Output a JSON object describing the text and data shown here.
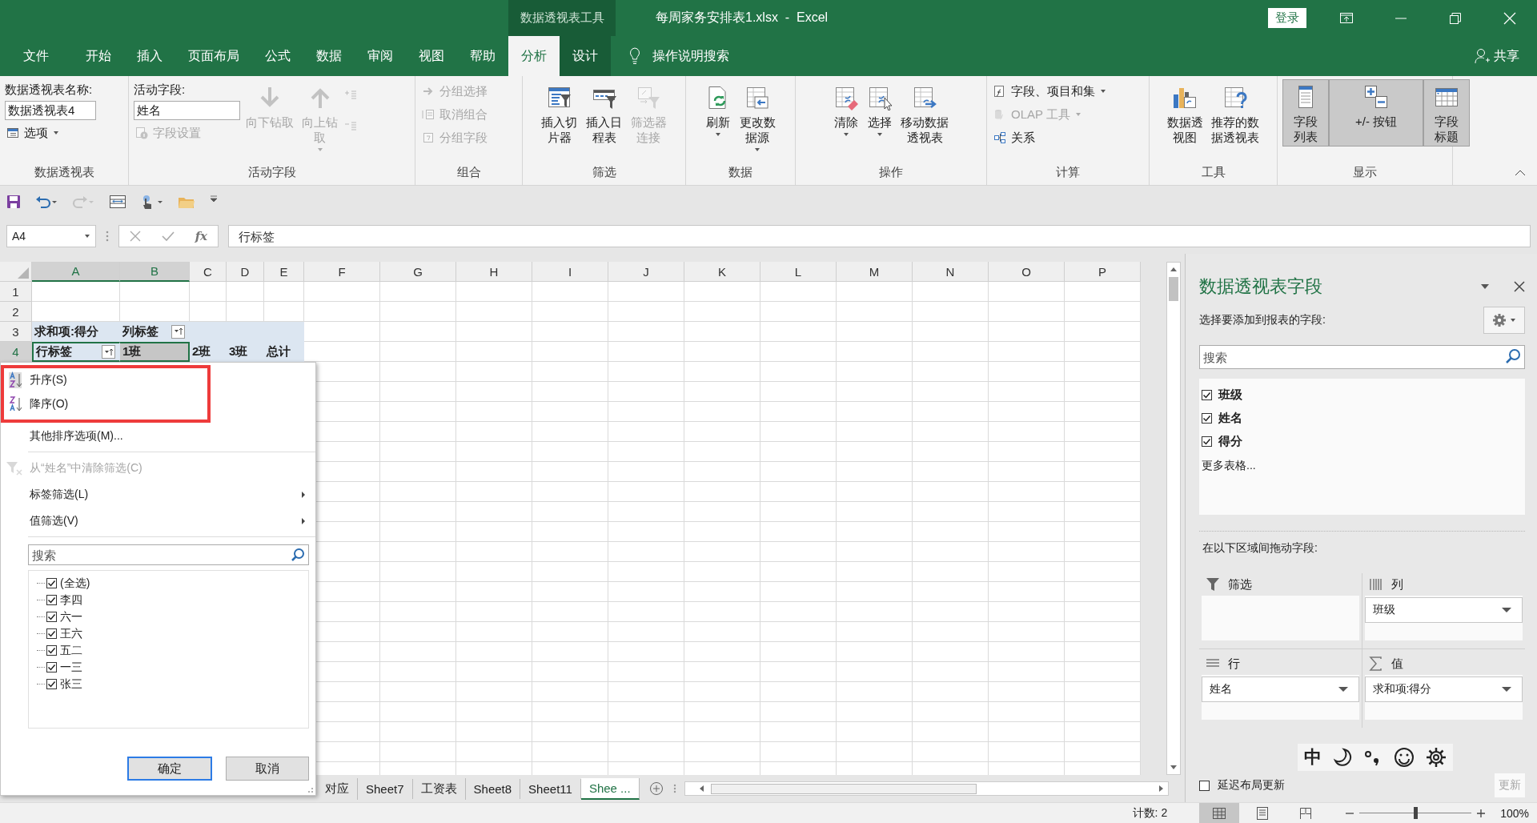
{
  "title_bar": {
    "context_label": "数据透视表工具",
    "title": "每周家务安排表1.xlsx  -  Excel",
    "sign_in": "登录"
  },
  "tabs": [
    {
      "label": "文件",
      "selected": false,
      "contextual": false
    },
    {
      "label": "开始",
      "selected": false,
      "contextual": false
    },
    {
      "label": "插入",
      "selected": false,
      "contextual": false
    },
    {
      "label": "页面布局",
      "selected": false,
      "contextual": false
    },
    {
      "label": "公式",
      "selected": false,
      "contextual": false
    },
    {
      "label": "数据",
      "selected": false,
      "contextual": false
    },
    {
      "label": "审阅",
      "selected": false,
      "contextual": false
    },
    {
      "label": "视图",
      "selected": false,
      "contextual": false
    },
    {
      "label": "帮助",
      "selected": false,
      "contextual": false
    },
    {
      "label": "分析",
      "selected": true,
      "contextual": true
    },
    {
      "label": "设计",
      "selected": false,
      "contextual": true
    }
  ],
  "tell_me": "操作说明搜索",
  "share": "共享",
  "ribbon": [
    {
      "label": "数据透视表",
      "columns": [
        [
          {
            "kind": "caption",
            "text": "数据透视表名称:"
          },
          {
            "kind": "input",
            "value": "数据透视表4"
          },
          {
            "kind": "small",
            "label": "选项",
            "dropdown": true,
            "disabled": false
          }
        ]
      ]
    },
    {
      "label": "活动字段",
      "columns": [
        [
          {
            "kind": "caption",
            "text": "活动字段:"
          },
          {
            "kind": "input",
            "value": "姓名"
          },
          {
            "kind": "small",
            "label": "字段设置",
            "dropdown": false,
            "disabled": true
          }
        ],
        [
          {
            "kind": "large",
            "label": "向下钻取",
            "dropdown": false,
            "disabled": true
          }
        ],
        [
          {
            "kind": "large",
            "label": "向上钻取",
            "dropdown": true,
            "disabled": true
          }
        ],
        [
          {
            "kind": "icon",
            "disabled": true
          },
          {
            "kind": "icon",
            "disabled": true
          }
        ]
      ]
    },
    {
      "label": "组合",
      "columns": [
        [
          {
            "kind": "small",
            "label": "分组选择",
            "dropdown": false,
            "disabled": true
          },
          {
            "kind": "small",
            "label": "取消组合",
            "dropdown": false,
            "disabled": true
          },
          {
            "kind": "small",
            "label": "分组字段",
            "dropdown": false,
            "disabled": true
          }
        ]
      ]
    },
    {
      "label": "筛选",
      "columns": [
        [
          {
            "kind": "large",
            "label": "插入切片器",
            "dropdown": false,
            "disabled": false
          }
        ],
        [
          {
            "kind": "large",
            "label": "插入日程表",
            "dropdown": false,
            "disabled": false
          }
        ],
        [
          {
            "kind": "large",
            "label": "筛选器连接",
            "dropdown": false,
            "disabled": true
          }
        ]
      ]
    },
    {
      "label": "数据",
      "columns": [
        [
          {
            "kind": "large",
            "label": "刷新",
            "dropdown": true,
            "disabled": false
          }
        ],
        [
          {
            "kind": "large",
            "label": "更改数据源",
            "dropdown": true,
            "disabled": false
          }
        ]
      ]
    },
    {
      "label": "操作",
      "columns": [
        [
          {
            "kind": "large",
            "label": "清除",
            "dropdown": true,
            "disabled": false
          }
        ],
        [
          {
            "kind": "large",
            "label": "选择",
            "dropdown": true,
            "disabled": false
          }
        ],
        [
          {
            "kind": "large",
            "label": "移动数据透视表",
            "dropdown": false,
            "disabled": false
          }
        ]
      ]
    },
    {
      "label": "计算",
      "columns": [
        [
          {
            "kind": "small",
            "label": "字段、项目和集",
            "dropdown": true,
            "disabled": false
          },
          {
            "kind": "small",
            "label": "OLAP 工具",
            "dropdown": true,
            "disabled": true
          },
          {
            "kind": "small",
            "label": "关系",
            "dropdown": false,
            "disabled": false
          }
        ]
      ]
    },
    {
      "label": "工具",
      "columns": [
        [
          {
            "kind": "large",
            "label": "数据透视图",
            "dropdown": false,
            "disabled": false
          }
        ],
        [
          {
            "kind": "large",
            "label": "推荐的数据透视表",
            "dropdown": false,
            "disabled": false
          }
        ]
      ]
    },
    {
      "label": "显示",
      "columns": [
        [
          {
            "kind": "toggle",
            "label": "字段列表",
            "selected": true
          }
        ],
        [
          {
            "kind": "toggle",
            "label": "+/- 按钮",
            "selected": true
          }
        ],
        [
          {
            "kind": "toggle",
            "label": "字段标题",
            "selected": true
          }
        ]
      ]
    }
  ],
  "quick_access": [
    {
      "disabled": false
    },
    {
      "disabled": false
    },
    {
      "disabled": true
    },
    {
      "disabled": false
    },
    {
      "disabled": false
    },
    {
      "disabled": false
    },
    {
      "disabled": false
    }
  ],
  "formula_bar": {
    "name_box": "A4",
    "function_label": "fx",
    "value": "行标签"
  },
  "sheet": {
    "columns": [
      {
        "label": "A",
        "selected": true
      },
      {
        "label": "B",
        "selected": true
      },
      {
        "label": "C",
        "selected": false
      },
      {
        "label": "D",
        "selected": false
      },
      {
        "label": "E",
        "selected": false
      },
      {
        "label": "F",
        "selected": false
      },
      {
        "label": "G",
        "selected": false
      },
      {
        "label": "H",
        "selected": false
      },
      {
        "label": "I",
        "selected": false
      },
      {
        "label": "J",
        "selected": false
      },
      {
        "label": "K",
        "selected": false
      },
      {
        "label": "L",
        "selected": false
      },
      {
        "label": "M",
        "selected": false
      },
      {
        "label": "N",
        "selected": false
      },
      {
        "label": "O",
        "selected": false
      },
      {
        "label": "P",
        "selected": false
      }
    ],
    "rows": [
      {
        "number": "1",
        "selected": false,
        "pivot": false
      },
      {
        "number": "2",
        "selected": false,
        "pivot": false
      },
      {
        "number": "3",
        "selected": false,
        "pivot": true,
        "cells": [
          {
            "text": "求和项:得分",
            "filter_button": false,
            "selected": false
          },
          {
            "text": "列标签",
            "filter_button": true,
            "selected": false
          }
        ]
      },
      {
        "number": "4",
        "selected": true,
        "pivot": true,
        "cells": [
          {
            "text": "行标签",
            "filter_button": true,
            "selected": true
          },
          {
            "text": "1班",
            "filter_button": false,
            "selected": true
          },
          {
            "text": "2班",
            "filter_button": false,
            "selected": false
          },
          {
            "text": "3班",
            "filter_button": false,
            "selected": false
          },
          {
            "text": "总计",
            "filter_button": false,
            "selected": false
          }
        ]
      }
    ]
  },
  "sheet_tabs": [
    {
      "label": "对应",
      "selected": false
    },
    {
      "label": "Sheet7",
      "selected": false
    },
    {
      "label": "工资表",
      "selected": false
    },
    {
      "label": "Sheet8",
      "selected": false
    },
    {
      "label": "Sheet11",
      "selected": false
    },
    {
      "label": "Shee ...",
      "selected": true
    }
  ],
  "filter_menu": {
    "items": [
      {
        "kind": "sort",
        "label": "升序(S)",
        "highlighted": true,
        "disabled": false
      },
      {
        "kind": "sort",
        "label": "降序(O)",
        "highlighted": true,
        "disabled": false
      },
      {
        "kind": "command",
        "label": "其他排序选项(M)...",
        "highlighted": false,
        "disabled": false
      },
      {
        "kind": "separator"
      },
      {
        "kind": "clear",
        "label": "从“姓名”中清除筛选(C)",
        "highlighted": false,
        "disabled": true
      },
      {
        "kind": "submenu",
        "label": "标签筛选(L)",
        "highlighted": false,
        "disabled": false
      },
      {
        "kind": "submenu",
        "label": "值筛选(V)",
        "highlighted": false,
        "disabled": false
      },
      {
        "kind": "separator"
      }
    ],
    "search_placeholder": "搜索",
    "values": [
      {
        "label": "(全选)",
        "checked": true
      },
      {
        "label": "李四",
        "checked": true
      },
      {
        "label": "六一",
        "checked": true
      },
      {
        "label": "王六",
        "checked": true
      },
      {
        "label": "五二",
        "checked": true
      },
      {
        "label": "一三",
        "checked": true
      },
      {
        "label": "张三",
        "checked": true
      }
    ],
    "buttons": [
      {
        "label": "确定",
        "default": true
      },
      {
        "label": "取消",
        "default": false
      }
    ]
  },
  "panel": {
    "title": "数据透视表字段",
    "subtitle": "选择要添加到报表的字段:",
    "search_placeholder": "搜索",
    "fields": [
      {
        "label": "班级",
        "checked": true
      },
      {
        "label": "姓名",
        "checked": true
      },
      {
        "label": "得分",
        "checked": true
      }
    ],
    "more_tables": "更多表格...",
    "areas_caption": "在以下区域间拖动字段:",
    "areas": [
      {
        "kind": "filters",
        "label": "筛选"
      },
      {
        "kind": "columns",
        "label": "列",
        "items": [
          "班级"
        ]
      },
      {
        "kind": "rows",
        "label": "行",
        "items": [
          "姓名"
        ]
      },
      {
        "kind": "values",
        "label": "值",
        "items": [
          "求和项:得分"
        ]
      }
    ],
    "defer_update": {
      "label": "延迟布局更新",
      "checked": false
    },
    "update_button": {
      "label": "更新",
      "disabled": true
    },
    "ime_toolbar": {
      "mode": "中"
    }
  },
  "status_bar": {
    "count": "计数: 2",
    "views": [
      {
        "selected": true
      },
      {
        "selected": false
      },
      {
        "selected": false
      }
    ],
    "zoom": {
      "level": 0.5,
      "label": "100%"
    }
  }
}
